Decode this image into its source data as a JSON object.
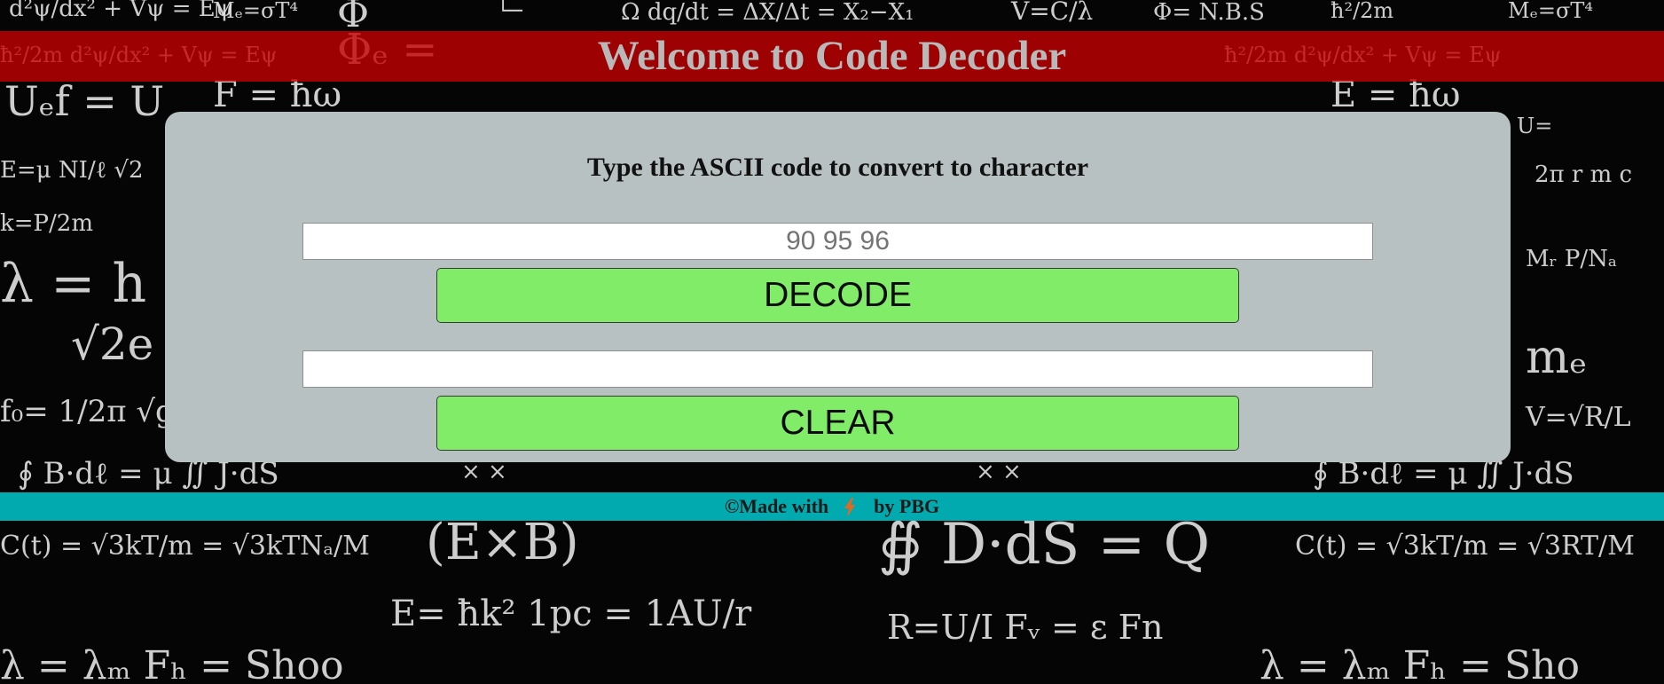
{
  "header": {
    "title": "Welcome to Code Decoder"
  },
  "card": {
    "title": "Type the ASCII code to convert to character",
    "input": {
      "value": "",
      "placeholder": "90 95 96"
    },
    "decode_label": "DECODE",
    "output": {
      "value": "",
      "placeholder": ""
    },
    "clear_label": "CLEAR"
  },
  "footer": {
    "made_with": "©Made with",
    "icon": "lightning-bolt-icon",
    "by": "by PBG"
  },
  "colors": {
    "banner": "#c40000",
    "card": "#b8c1c1",
    "button": "#81ec68",
    "footer": "#00c8cd",
    "bolt": "#e8671f"
  }
}
